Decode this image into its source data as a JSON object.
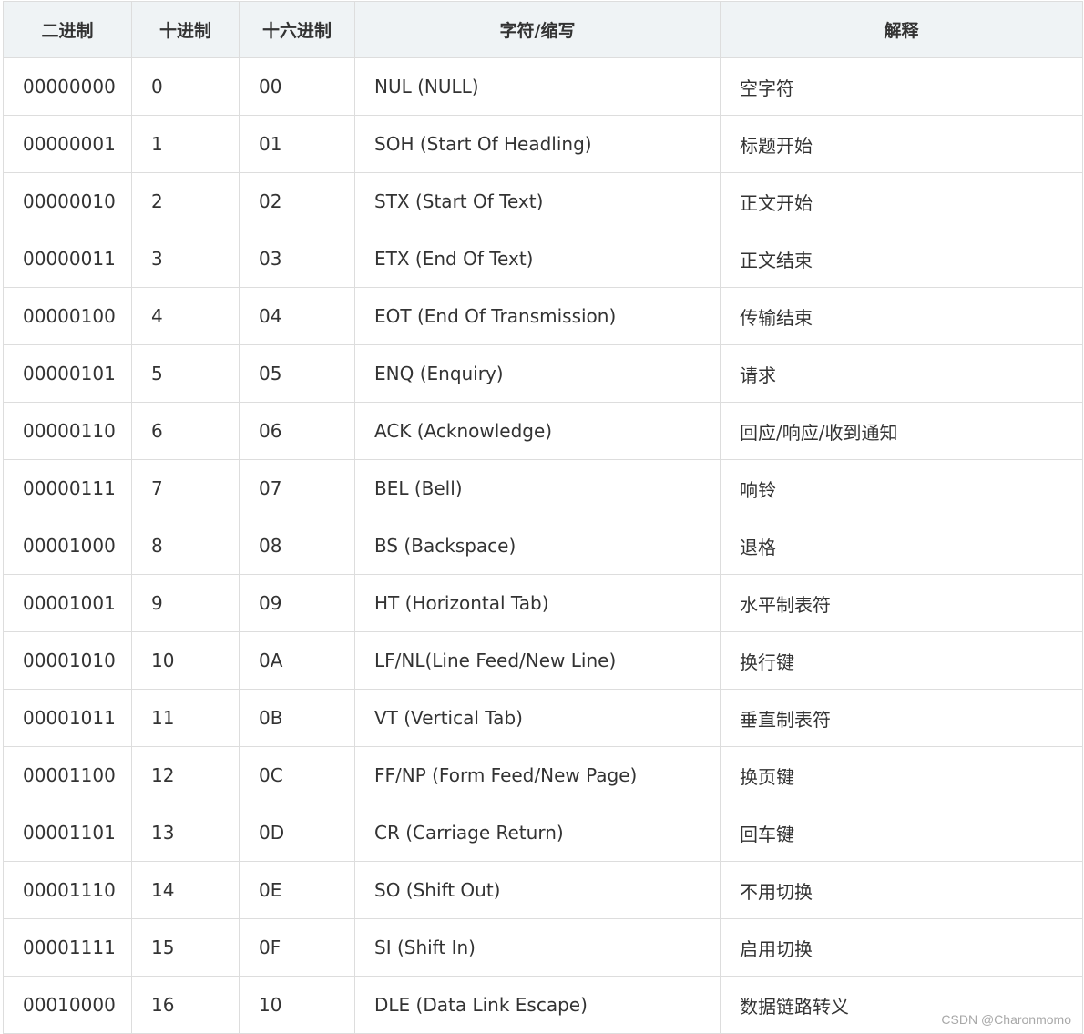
{
  "table": {
    "headers": [
      "二进制",
      "十进制",
      "十六进制",
      "字符/缩写",
      "解释"
    ],
    "rows": [
      [
        "00000000",
        "0",
        "00",
        "NUL (NULL)",
        "空字符"
      ],
      [
        "00000001",
        "1",
        "01",
        "SOH (Start Of Headling)",
        "标题开始"
      ],
      [
        "00000010",
        "2",
        "02",
        "STX (Start Of Text)",
        "正文开始"
      ],
      [
        "00000011",
        "3",
        "03",
        "ETX (End Of Text)",
        "正文结束"
      ],
      [
        "00000100",
        "4",
        "04",
        "EOT (End Of Transmission)",
        "传输结束"
      ],
      [
        "00000101",
        "5",
        "05",
        "ENQ (Enquiry)",
        "请求"
      ],
      [
        "00000110",
        "6",
        "06",
        "ACK (Acknowledge)",
        "回应/响应/收到通知"
      ],
      [
        "00000111",
        "7",
        "07",
        "BEL (Bell)",
        "响铃"
      ],
      [
        "00001000",
        "8",
        "08",
        "BS (Backspace)",
        "退格"
      ],
      [
        "00001001",
        "9",
        "09",
        "HT (Horizontal Tab)",
        "水平制表符"
      ],
      [
        "00001010",
        "10",
        "0A",
        "LF/NL(Line Feed/New Line)",
        "换行键"
      ],
      [
        "00001011",
        "11",
        "0B",
        "VT (Vertical Tab)",
        "垂直制表符"
      ],
      [
        "00001100",
        "12",
        "0C",
        "FF/NP (Form Feed/New Page)",
        "换页键"
      ],
      [
        "00001101",
        "13",
        "0D",
        "CR (Carriage Return)",
        "回车键"
      ],
      [
        "00001110",
        "14",
        "0E",
        "SO (Shift Out)",
        "不用切换"
      ],
      [
        "00001111",
        "15",
        "0F",
        "SI (Shift In)",
        "启用切换"
      ],
      [
        "00010000",
        "16",
        "10",
        "DLE (Data Link Escape)",
        "数据链路转义"
      ]
    ]
  },
  "watermark": "CSDN @Charonmomo"
}
